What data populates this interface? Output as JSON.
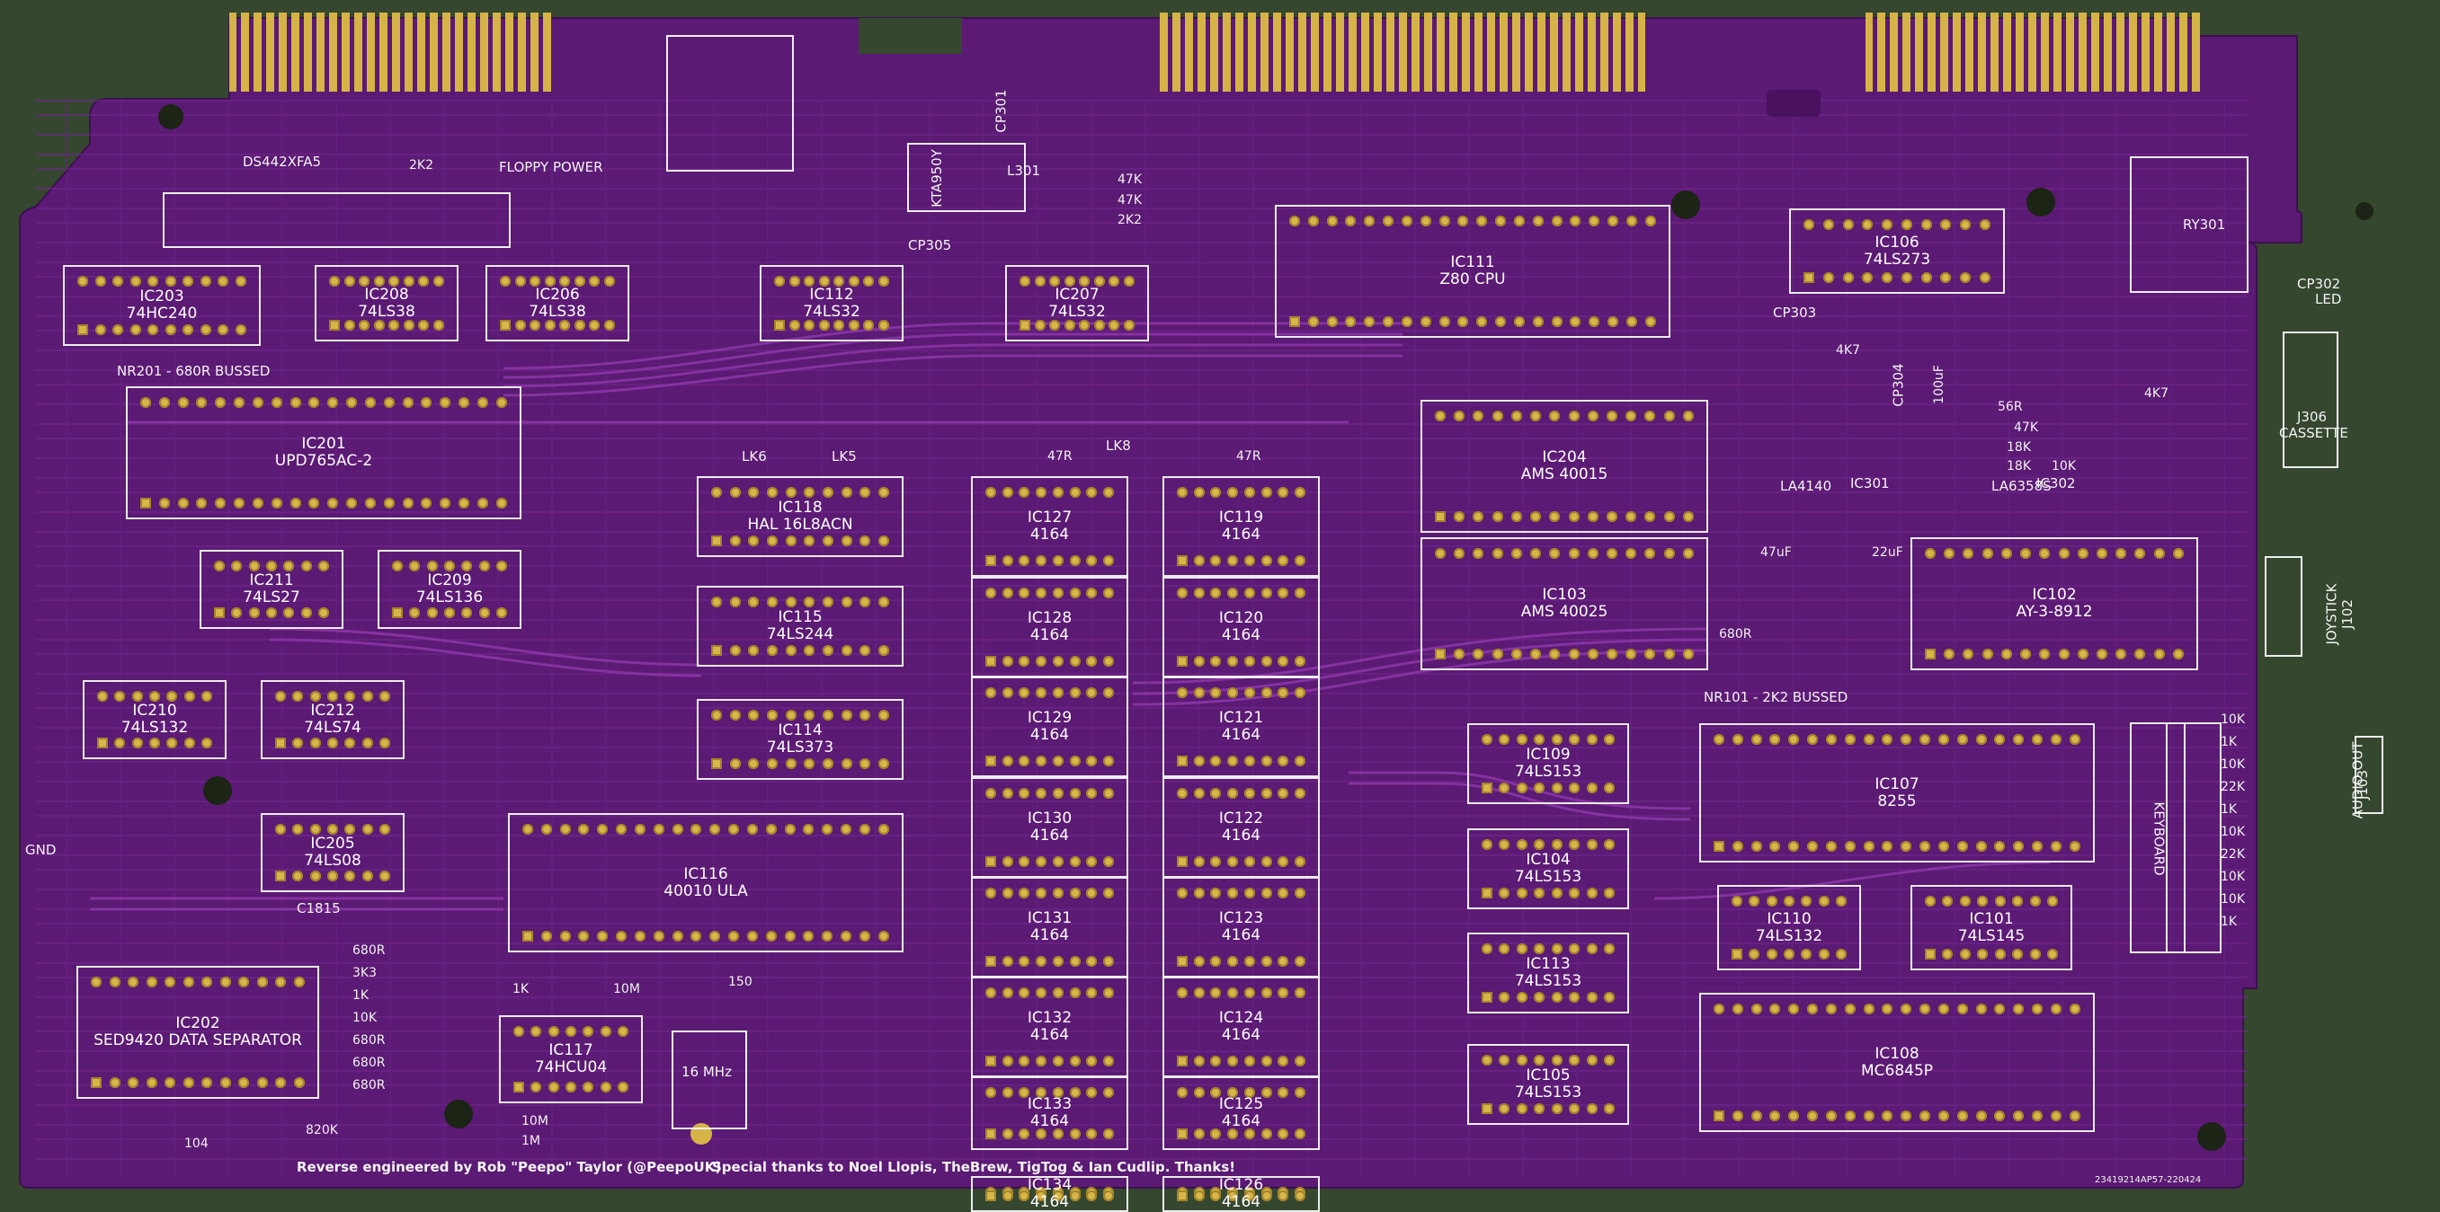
{
  "colors": {
    "background": "#35472f",
    "board": "#5b1a73",
    "trace": "#7a2b96",
    "silk": "#f2f2f2",
    "gold": "#d6b347",
    "hole": "#1c2416"
  },
  "chips": [
    {
      "id": "IC203",
      "part": "74HC240"
    },
    {
      "id": "IC208",
      "part": "74LS38"
    },
    {
      "id": "IC206",
      "part": "74LS38"
    },
    {
      "id": "IC112",
      "part": "74LS32"
    },
    {
      "id": "IC207",
      "part": "74LS32"
    },
    {
      "id": "IC111",
      "part": "Z80 CPU"
    },
    {
      "id": "IC106",
      "part": "74LS273"
    },
    {
      "id": "IC201",
      "part": "UPD765AC-2"
    },
    {
      "id": "IC204",
      "part": "AMS 40015"
    },
    {
      "id": "IC103",
      "part": "AMS 40025"
    },
    {
      "id": "IC102",
      "part": "AY-3-8912"
    },
    {
      "id": "IC118",
      "part": "HAL 16L8ACN"
    },
    {
      "id": "IC115",
      "part": "74LS244"
    },
    {
      "id": "IC114",
      "part": "74LS373"
    },
    {
      "id": "IC211",
      "part": "74LS27"
    },
    {
      "id": "IC209",
      "part": "74LS136"
    },
    {
      "id": "IC210",
      "part": "74LS132"
    },
    {
      "id": "IC212",
      "part": "74LS74"
    },
    {
      "id": "IC205",
      "part": "74LS08"
    },
    {
      "id": "IC116",
      "part": "40010 ULA"
    },
    {
      "id": "IC202",
      "part": "SED9420 DATA SEPARATOR"
    },
    {
      "id": "IC117",
      "part": "74HCU04"
    },
    {
      "id": "IC127",
      "part": "4164"
    },
    {
      "id": "IC128",
      "part": "4164"
    },
    {
      "id": "IC129",
      "part": "4164"
    },
    {
      "id": "IC130",
      "part": "4164"
    },
    {
      "id": "IC131",
      "part": "4164"
    },
    {
      "id": "IC132",
      "part": "4164"
    },
    {
      "id": "IC133",
      "part": "4164"
    },
    {
      "id": "IC134",
      "part": "4164"
    },
    {
      "id": "IC119",
      "part": "4164"
    },
    {
      "id": "IC120",
      "part": "4164"
    },
    {
      "id": "IC121",
      "part": "4164"
    },
    {
      "id": "IC122",
      "part": "4164"
    },
    {
      "id": "IC123",
      "part": "4164"
    },
    {
      "id": "IC124",
      "part": "4164"
    },
    {
      "id": "IC125",
      "part": "4164"
    },
    {
      "id": "IC126",
      "part": "4164"
    },
    {
      "id": "IC109",
      "part": "74LS153"
    },
    {
      "id": "IC104",
      "part": "74LS153"
    },
    {
      "id": "IC113",
      "part": "74LS153"
    },
    {
      "id": "IC105",
      "part": "74LS153"
    },
    {
      "id": "IC107",
      "part": "8255"
    },
    {
      "id": "IC110",
      "part": "74LS132"
    },
    {
      "id": "IC101",
      "part": "74LS145"
    },
    {
      "id": "IC108",
      "part": "MC6845P"
    }
  ],
  "labels": {
    "ds442": "DS442XFA5",
    "floppy_power": "FLOPPY POWER",
    "nr201": "NR201 - 680R BUSSED",
    "nr101": "NR101 - 2K2 BUSSED",
    "ry301": "RY301",
    "cp301": "CP301",
    "cp302": "CP302",
    "cp303": "CP303",
    "cp304": "CP304",
    "cp305": "CP305",
    "l301": "L301",
    "kta": "KTA950Y",
    "ic301": "IC301",
    "la4140": "LA4140",
    "ic302": "IC302",
    "la6358": "LA6358S",
    "j306": "J306",
    "cassette": "CASSETTE",
    "led": "LED",
    "joystick": "JOYSTICK",
    "j102": "J102",
    "audio_out": "AUDIO OUT",
    "j103": "J103",
    "keyboard": "KEYBOARD",
    "gnd": "GND",
    "mhz": "16 MHz",
    "lk6": "LK6",
    "lk5": "LK5",
    "lk8": "LK8",
    "c1815": "C1815",
    "serial": "23419214AP57-220424"
  },
  "passives": {
    "r1": "2K2",
    "r2": "47R",
    "r3": "47R",
    "r4": "10M",
    "r5": "1M",
    "r6": "10M",
    "r7": "820K",
    "r8": "680R",
    "r9": "47K",
    "r10": "47K",
    "r11": "2K2",
    "r12": "1K",
    "r13": "150",
    "r14": "4K7",
    "r15": "56R",
    "r16": "47K",
    "r17": "18K",
    "r18": "18K",
    "r19": "10K",
    "r20": "4K7",
    "c1": "104",
    "c2": "100uF",
    "c3": "47uF",
    "c4": "22uF",
    "stack_res": [
      "680R",
      "3K3",
      "1K",
      "10K",
      "680R",
      "680R",
      "680R"
    ],
    "audio_res": [
      "10K",
      "1K",
      "10K",
      "22K",
      "1K",
      "10K",
      "22K",
      "10K",
      "10K",
      "1K"
    ]
  },
  "credits": {
    "left": "Reverse engineered by Rob \"Peepo\" Taylor (@PeepoUK)",
    "right": "Special thanks to Noel Llopis, TheBrew, TigTog & Ian Cudlip. Thanks!"
  }
}
